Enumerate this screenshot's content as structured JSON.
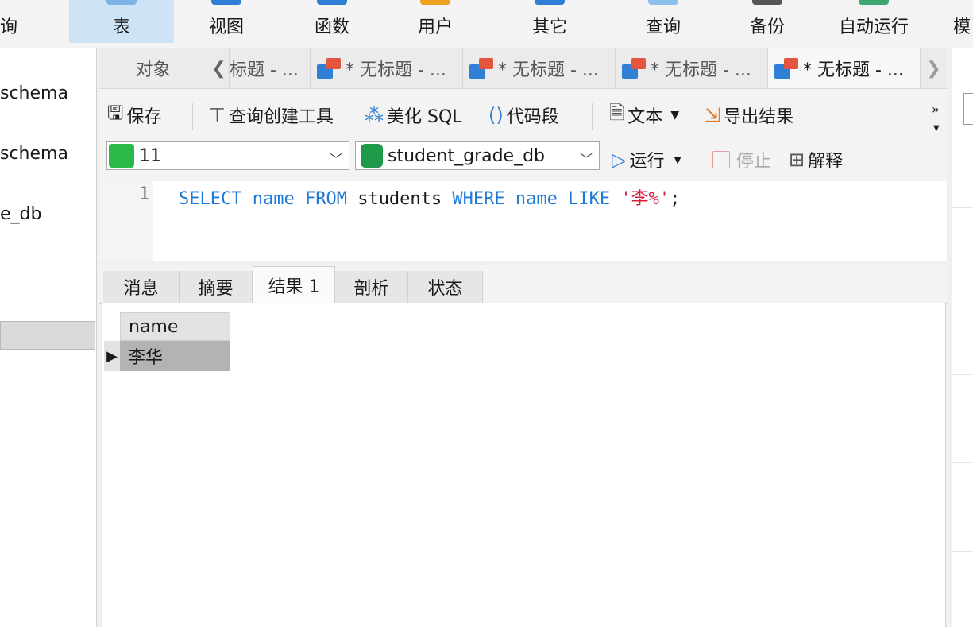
{
  "ribbon": {
    "partial_left": "询",
    "items": [
      "表",
      "视图",
      "函数",
      "用户",
      "其它",
      "查询",
      "备份",
      "自动运行"
    ],
    "partial_right": "模",
    "active": "表"
  },
  "sidebar": {
    "items": [
      "schema",
      "schema",
      "e_db"
    ]
  },
  "tabs": {
    "objects_label": "对象",
    "partial_first": "标题 - ...",
    "titles": [
      "* 无标题 - ...",
      "* 无标题 - ...",
      "* 无标题 - ...",
      "* 无标题 - ..."
    ]
  },
  "toolbar": {
    "save": "保存",
    "query_builder": "查询创建工具",
    "beautify": "美化 SQL",
    "snippet": "代码段",
    "text": "文本",
    "export": "导出结果"
  },
  "connection": {
    "server": "11",
    "database": "student_grade_db",
    "run": "运行",
    "stop": "停止",
    "explain": "解释"
  },
  "editor": {
    "line_number": "1",
    "tokens": [
      {
        "text": "SELECT",
        "color": "#1f7ad8"
      },
      {
        "text": " ",
        "color": "#1a1a1a"
      },
      {
        "text": "name",
        "color": "#1f7ad8"
      },
      {
        "text": " ",
        "color": "#1a1a1a"
      },
      {
        "text": "FROM",
        "color": "#1f7ad8"
      },
      {
        "text": " students ",
        "color": "#1a1a1a"
      },
      {
        "text": "WHERE",
        "color": "#1f7ad8"
      },
      {
        "text": " ",
        "color": "#1a1a1a"
      },
      {
        "text": "name",
        "color": "#1f7ad8"
      },
      {
        "text": " ",
        "color": "#1a1a1a"
      },
      {
        "text": "LIKE",
        "color": "#1f7ad8"
      },
      {
        "text": " ",
        "color": "#1a1a1a"
      },
      {
        "text": "'李%'",
        "color": "#d61f3b"
      },
      {
        "text": ";",
        "color": "#1a1a1a"
      }
    ]
  },
  "results": {
    "tabs": [
      "消息",
      "摘要",
      "结果 1",
      "剖析",
      "状态"
    ],
    "active_tab": "结果 1",
    "columns": [
      "name"
    ],
    "rows": [
      [
        "李华"
      ]
    ]
  },
  "colors": {
    "keyword": "#1f7ad8",
    "string": "#d61f3b",
    "active_ribbon": "#cfe3f7"
  }
}
